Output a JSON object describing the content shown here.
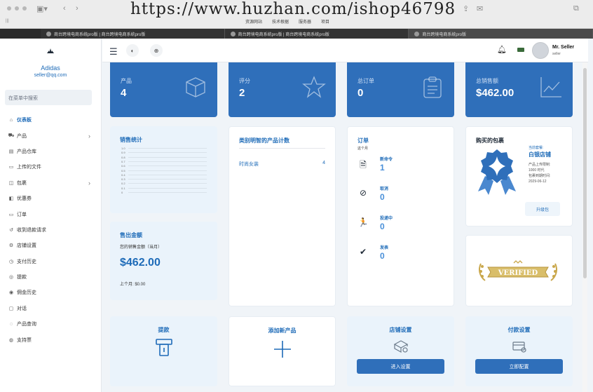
{
  "browser": {
    "watermark": "https://www.huzhan.com/ishop46798",
    "bookmarks": [
      "资源网站",
      "技术根据",
      "服务器",
      "项目"
    ],
    "tabs": [
      "商台跨境电商系统pro版 | 商台跨境电商系统pro版",
      "商台跨境电商系统pro版 | 商台跨境电商系统pro版",
      "商台跨境电商系统pro版"
    ]
  },
  "sidebar": {
    "brand_name": "Adidas",
    "brand_email": "seller@qq.com",
    "search_placeholder": "在菜单中搜索",
    "items": [
      {
        "label": "仪表板",
        "icon": "home-icon",
        "glyph": "⌂",
        "active": true,
        "chevron": false
      },
      {
        "label": "产品",
        "icon": "cart-icon",
        "glyph": "⛟",
        "active": false,
        "chevron": true
      },
      {
        "label": "产品仓库",
        "icon": "warehouse-icon",
        "glyph": "▤",
        "active": false,
        "chevron": false
      },
      {
        "label": "上传的文件",
        "icon": "folder-icon",
        "glyph": "▭",
        "active": false,
        "chevron": false
      },
      {
        "label": "包裹",
        "icon": "package-icon",
        "glyph": "◫",
        "active": false,
        "chevron": true
      },
      {
        "label": "优惠券",
        "icon": "coupon-icon",
        "glyph": "◧",
        "active": false,
        "chevron": false
      },
      {
        "label": "订单",
        "icon": "order-icon",
        "glyph": "▭",
        "active": false,
        "chevron": false
      },
      {
        "label": "收到退款请求",
        "icon": "refund-icon",
        "glyph": "↺",
        "active": false,
        "chevron": false
      },
      {
        "label": "店铺设置",
        "icon": "store-icon",
        "glyph": "⚙",
        "active": false,
        "chevron": false
      },
      {
        "label": "支付历史",
        "icon": "payment-history-icon",
        "glyph": "◷",
        "active": false,
        "chevron": false
      },
      {
        "label": "提款",
        "icon": "withdraw-icon",
        "glyph": "◎",
        "active": false,
        "chevron": false
      },
      {
        "label": "佣金历史",
        "icon": "commission-icon",
        "glyph": "◉",
        "active": false,
        "chevron": false
      },
      {
        "label": "对话",
        "icon": "chat-icon",
        "glyph": "▢",
        "active": false,
        "chevron": false
      },
      {
        "label": "产品查询",
        "icon": "query-icon",
        "glyph": "◌",
        "active": false,
        "chevron": false
      },
      {
        "label": "支持票",
        "icon": "ticket-icon",
        "glyph": "◍",
        "active": false,
        "chevron": false
      }
    ]
  },
  "topbar": {
    "user_name": "Mr. Seller",
    "user_role": "seller"
  },
  "stats": [
    {
      "label": "产品",
      "value": "4",
      "icon": "box-icon"
    },
    {
      "label": "评分",
      "value": "2",
      "icon": "star-icon"
    },
    {
      "label": "总订单",
      "value": "0",
      "icon": "clipboard-icon"
    },
    {
      "label": "总销售额",
      "value": "$462.00",
      "icon": "trend-icon"
    }
  ],
  "sales_stats": {
    "title": "销售统计",
    "ticks": [
      "1.0",
      "0.9",
      "0.8",
      "0.7",
      "0.6",
      "0.5",
      "0.4",
      "0.3",
      "0.2",
      "0.1",
      "0"
    ]
  },
  "sold_amount": {
    "title": "售出金额",
    "subtitle": "您的销售金额（当月）",
    "value": "$462.00",
    "last_month": "上个月: $0.00"
  },
  "category_count": {
    "title": "类别明智的产品计数",
    "rows": [
      {
        "name": "时尚女装",
        "count": "4"
      }
    ]
  },
  "orders": {
    "title": "订单",
    "subtitle": "这个月",
    "items": [
      {
        "label": "新命令",
        "value": "1",
        "icon": "new-order-icon",
        "glyph": "🗎"
      },
      {
        "label": "取消",
        "value": "0",
        "icon": "cancel-order-icon",
        "glyph": "⊘"
      },
      {
        "label": "投递中",
        "value": "0",
        "icon": "delivery-icon",
        "glyph": "🏃"
      },
      {
        "label": "发表",
        "value": "0",
        "icon": "delivered-icon",
        "glyph": "✔"
      }
    ]
  },
  "package": {
    "title": "购买的包裹",
    "current_label": "当前套餐:",
    "plan_name": "白银店铺",
    "upload_limit": "产品上传限制:",
    "upload_value": "1000 时代",
    "expiry_label": "包裹到期时间:",
    "expiry_value": "2029-06-12",
    "upgrade_label": "升级包"
  },
  "verified_text": "VERIFIED",
  "actions": [
    {
      "title": "提款",
      "icon": "withdraw-card-icon",
      "button": ""
    },
    {
      "title": "添加新产品",
      "icon": "plus-icon",
      "button": ""
    },
    {
      "title": "店铺设置",
      "icon": "store-settings-icon",
      "button": "进入设置"
    },
    {
      "title": "付款设置",
      "icon": "payment-settings-icon",
      "button": "立即配置"
    }
  ]
}
